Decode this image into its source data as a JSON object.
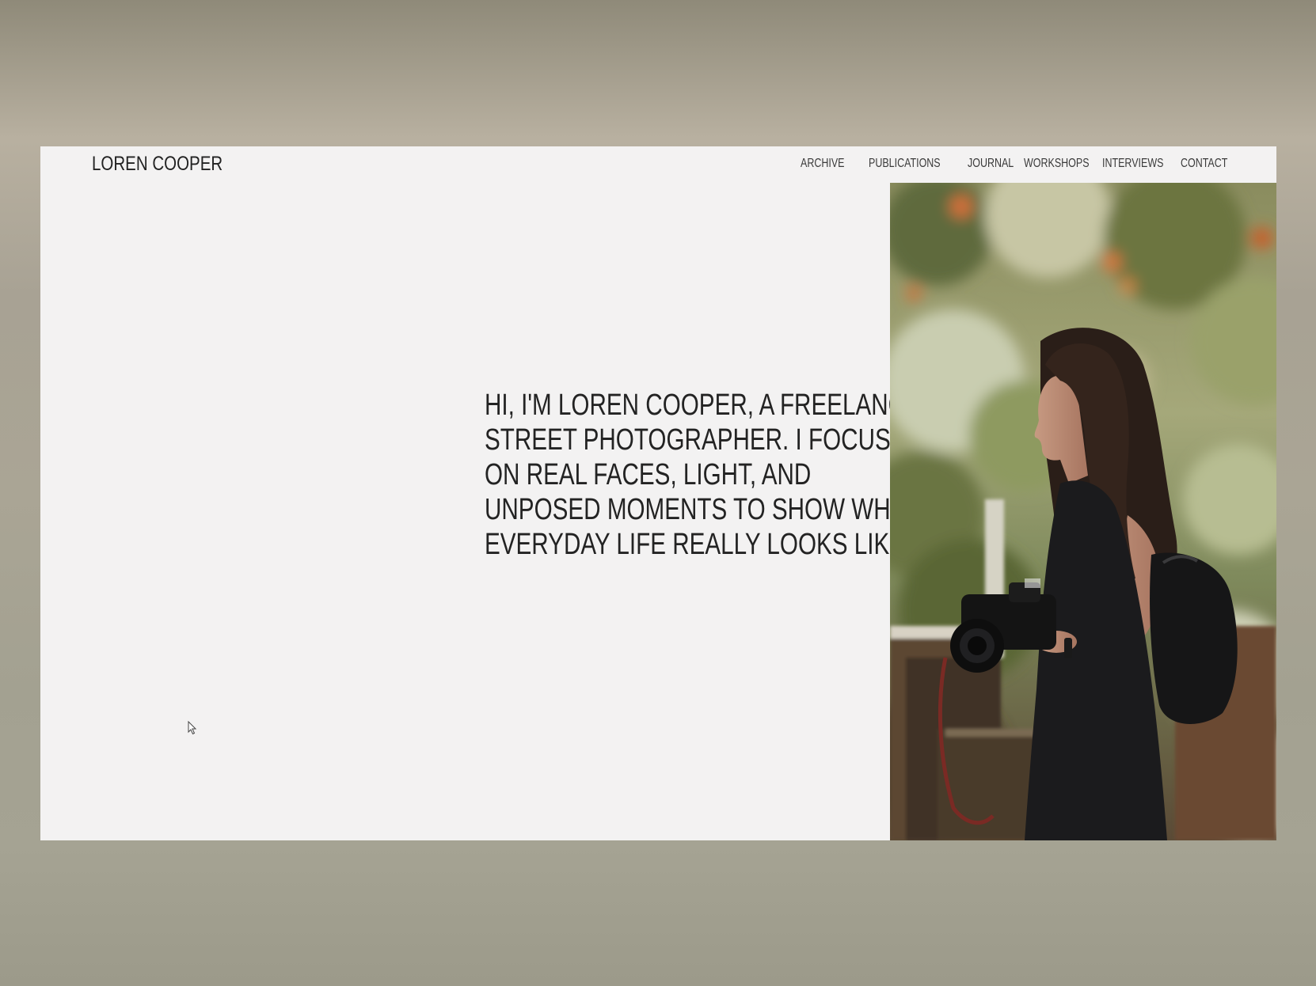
{
  "site": {
    "logo": "LOREN COOPER"
  },
  "nav": {
    "items": [
      {
        "label": "ARCHIVE"
      },
      {
        "label": "PUBLICATIONS"
      },
      {
        "label": "JOURNAL"
      },
      {
        "label": "WORKSHOPS"
      },
      {
        "label": "INTERVIEWS"
      },
      {
        "label": "CONTACT"
      }
    ]
  },
  "hero": {
    "lines": [
      "HI, I'M LOREN COOPER, A FREELANCE",
      "STREET PHOTOGRAPHER. I FOCUS",
      "ON REAL FACES, LIGHT, AND",
      "UNPOSED MOMENTS TO SHOW WHAT",
      "EVERYDAY LIFE REALLY LOOKS LIKE."
    ]
  },
  "colors": {
    "page_background": "#f3f2f2",
    "text": "#232323",
    "nav_text": "#3a3a3a",
    "outer_backdrop": "#a8a294"
  },
  "icons": {
    "cursor": "mouse-pointer-icon"
  }
}
